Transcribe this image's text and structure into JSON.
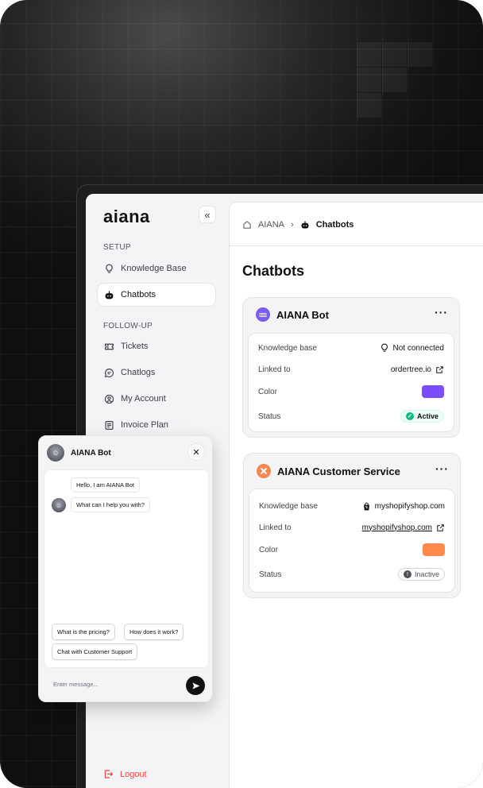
{
  "brand": {
    "logo": "aiana"
  },
  "sidebar": {
    "setup_label": "SETUP",
    "followup_label": "FOLLOW-UP",
    "items": [
      {
        "label": "Knowledge Base",
        "icon": "lightbulb-icon"
      },
      {
        "label": "Chatbots",
        "icon": "bot-icon",
        "active": true
      },
      {
        "label": "Tickets",
        "icon": "ticket-icon"
      },
      {
        "label": "Chatlogs",
        "icon": "chat-bubble-icon"
      },
      {
        "label": "My Account",
        "icon": "user-circle-icon"
      },
      {
        "label": "Invoice Plan",
        "icon": "invoice-icon"
      }
    ],
    "logout": "Logout"
  },
  "breadcrumb": {
    "home": "AIANA",
    "current": "Chatbots"
  },
  "page": {
    "title": "Chatbots"
  },
  "bots": [
    {
      "name": "AIANA Bot",
      "icon_color": "#7c5cf0",
      "rows": {
        "kb_label": "Knowledge base",
        "kb_value": "Not connected",
        "linked_label": "Linked to",
        "linked_value": "ordertree.io",
        "color_label": "Color",
        "color_value": "#7c4dff",
        "status_label": "Status",
        "status_value": "Active"
      }
    },
    {
      "name": "AIANA Customer Service",
      "icon_color": "#f5874f",
      "rows": {
        "kb_label": "Knowledge base",
        "kb_value": "myshopifyshop.com",
        "linked_label": "Linked to",
        "linked_value": "myshopifyshop.com",
        "color_label": "Color",
        "color_value": "#ff8a4c",
        "status_label": "Status",
        "status_value": "Inactive"
      }
    }
  ],
  "chat_widget": {
    "title": "AIANA Bot",
    "messages": [
      "Hello, I am AIANA Bot",
      "What can I help you with?"
    ],
    "suggestions": [
      "What is the pricing?",
      "How does it work?",
      "Chat with Customer Support"
    ],
    "input_placeholder": "Enter message..."
  },
  "colors": {
    "active_green": "#10b981",
    "logout_red": "#ef4444"
  }
}
